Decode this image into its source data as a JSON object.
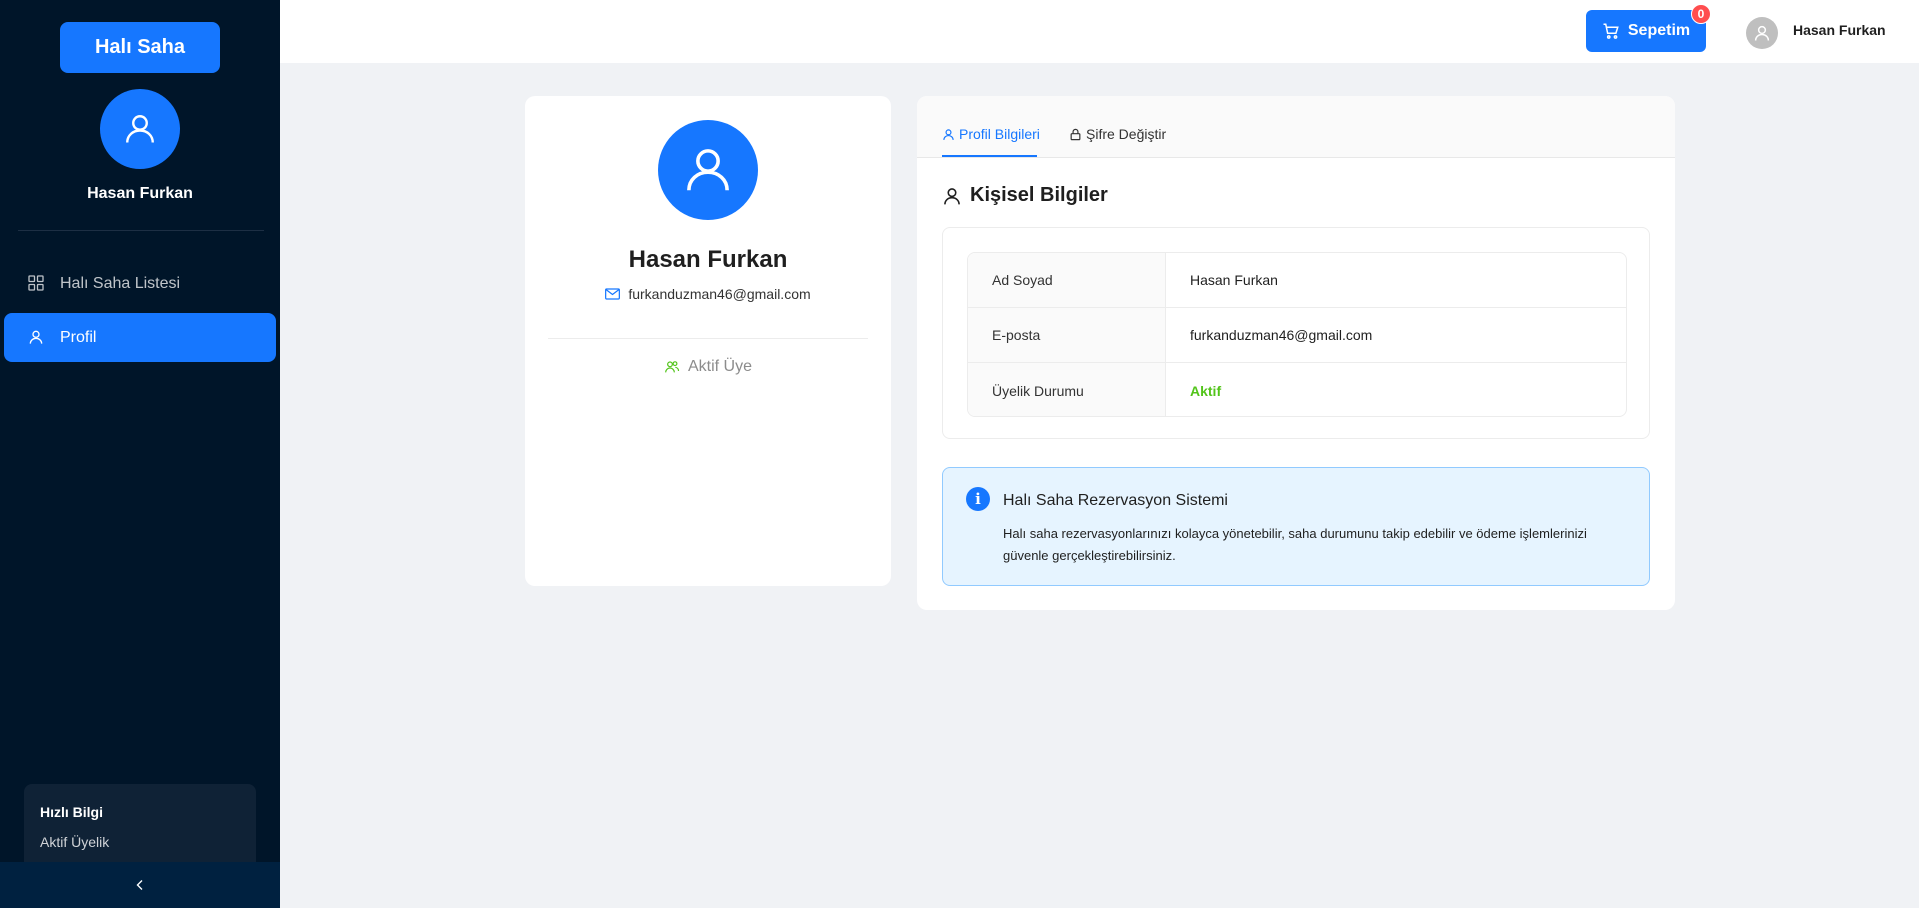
{
  "sidebar": {
    "brand": "Halı Saha",
    "username": "Hasan Furkan",
    "menu": [
      {
        "label": "Halı Saha Listesi",
        "icon": "grid-icon",
        "active": false
      },
      {
        "label": "Profil",
        "icon": "user-icon",
        "active": true
      }
    ],
    "quick_info": {
      "title": "Hızlı Bilgi",
      "text": "Aktif Üyelik"
    },
    "collapse_icon": "chevron-left-icon"
  },
  "header": {
    "cart_label": "Sepetim",
    "cart_count": "0",
    "username": "Hasan Furkan"
  },
  "profile_card": {
    "name": "Hasan Furkan",
    "email": "furkanduzman46@gmail.com",
    "status": "Aktif Üye"
  },
  "info_card": {
    "tabs": [
      {
        "label": "Profil Bilgileri",
        "icon": "user-icon",
        "active": true
      },
      {
        "label": "Şifre Değiştir",
        "icon": "lock-icon",
        "active": false
      }
    ],
    "section_title": "Kişisel Bilgiler",
    "rows": [
      {
        "label": "Ad Soyad",
        "value": "Hasan Furkan"
      },
      {
        "label": "E-posta",
        "value": "furkanduzman46@gmail.com"
      },
      {
        "label": "Üyelik Durumu",
        "value": "Aktif"
      }
    ],
    "alert": {
      "title": "Halı Saha Rezervasyon Sistemi",
      "text": "Halı saha rezervasyonlarınızı kolayca yönetebilir, saha durumunu takip edebilir ve ödeme işlemlerinizi güvenle gerçekleştirebilirsiniz."
    }
  },
  "colors": {
    "primary": "#1677ff",
    "sidebar_bg": "#001529",
    "success": "#52c41a",
    "badge": "#ff4d4f",
    "page_bg": "#f0f2f5"
  }
}
